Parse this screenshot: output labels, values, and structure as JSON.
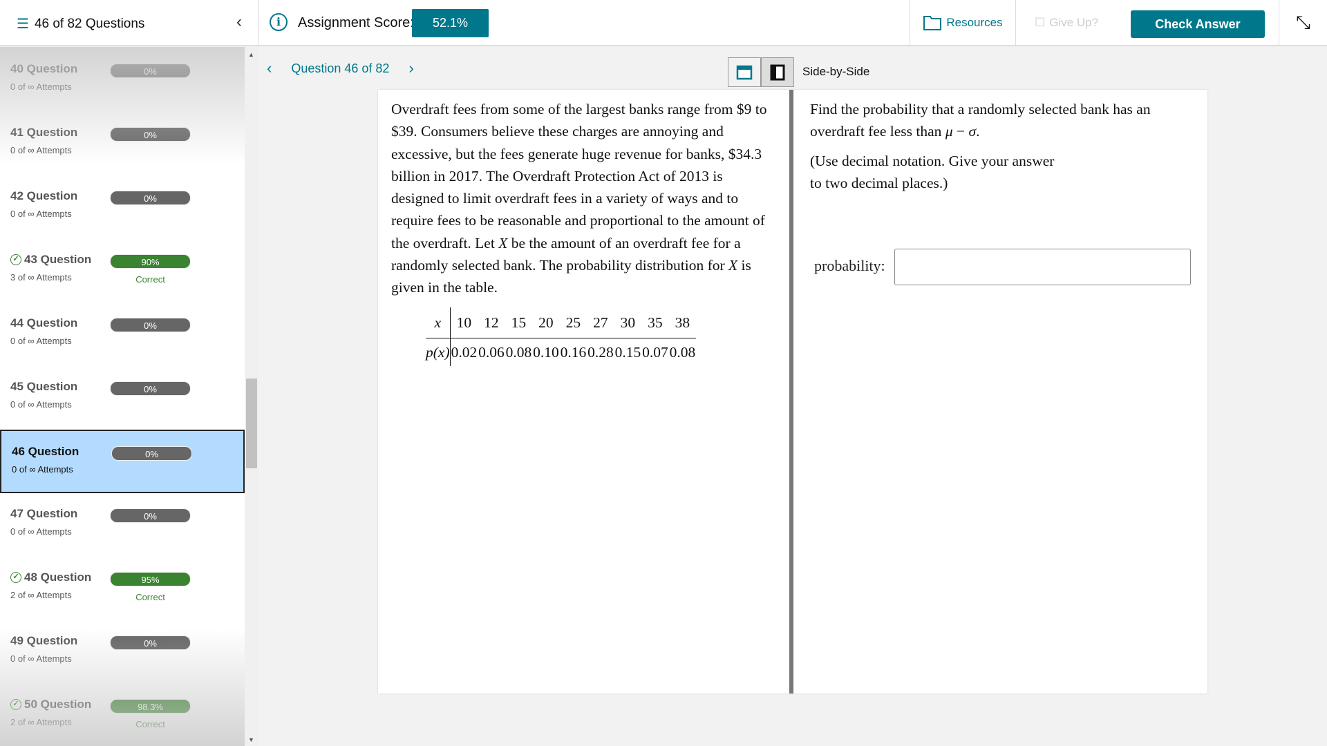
{
  "header": {
    "question_count": "46 of 82 Questions",
    "score_label": "Assignment Score:",
    "score": "52.1%",
    "resources": "Resources",
    "give_up": "Give Up?",
    "check_answer": "Check Answer"
  },
  "sidebar": {
    "items": [
      {
        "name": "40 Question",
        "attempts": "0 of ∞ Attempts",
        "score": "0%",
        "status": "",
        "correct": false
      },
      {
        "name": "41 Question",
        "attempts": "0 of ∞ Attempts",
        "score": "0%",
        "status": "",
        "correct": false
      },
      {
        "name": "42 Question",
        "attempts": "0 of ∞ Attempts",
        "score": "0%",
        "status": "",
        "correct": false
      },
      {
        "name": "43 Question",
        "attempts": "3 of ∞ Attempts",
        "score": "90%",
        "status": "Correct",
        "correct": true
      },
      {
        "name": "44 Question",
        "attempts": "0 of ∞ Attempts",
        "score": "0%",
        "status": "",
        "correct": false
      },
      {
        "name": "45 Question",
        "attempts": "0 of ∞ Attempts",
        "score": "0%",
        "status": "",
        "correct": false
      },
      {
        "name": "46 Question",
        "attempts": "0 of ∞ Attempts",
        "score": "0%",
        "status": "",
        "correct": false,
        "selected": true
      },
      {
        "name": "47 Question",
        "attempts": "0 of ∞ Attempts",
        "score": "0%",
        "status": "",
        "correct": false
      },
      {
        "name": "48 Question",
        "attempts": "2 of ∞ Attempts",
        "score": "95%",
        "status": "Correct",
        "correct": true
      },
      {
        "name": "49 Question",
        "attempts": "0 of ∞ Attempts",
        "score": "0%",
        "status": "",
        "correct": false
      },
      {
        "name": "50 Question",
        "attempts": "2 of ∞ Attempts",
        "score": "98.3%",
        "status": "Correct",
        "correct": true
      }
    ]
  },
  "nav": {
    "label": "Question 46 of 82",
    "view_mode": "Side-by-Side"
  },
  "question": {
    "stem_html": "Overdraft fees from some of the largest banks range from $9 to $39. Consumers believe these charges are annoying and excessive, but the fees generate huge revenue for banks, $34.3 billion in 2017. The Overdraft Protection Act of 2013 is designed to limit overdraft fees in a variety of ways and to require fees to be reasonable and proportional to the amount of the overdraft. Let <i>X</i> be the amount of an overdraft fee for a randomly selected bank. The probability distribution for <i>X</i> is given in the table.",
    "table": {
      "x_label": "x",
      "p_label": "p(x)",
      "x": [
        "10",
        "12",
        "15",
        "20",
        "25",
        "27",
        "30",
        "35",
        "38"
      ],
      "p": [
        "0.02",
        "0.06",
        "0.08",
        "0.10",
        "0.16",
        "0.28",
        "0.15",
        "0.07",
        "0.08"
      ]
    },
    "prompt_html": "Find the probability that a randomly selected bank has an overdraft fee less than <i>μ</i> − <i>σ</i>.",
    "note": "(Use decimal notation. Give your answer to two decimal places.)",
    "answer_label": "probability:",
    "answer_value": ""
  },
  "colors": {
    "accent": "#00778b",
    "correct": "#3a8330",
    "selected": "#b3dbff",
    "zero_bar": "#666666"
  }
}
